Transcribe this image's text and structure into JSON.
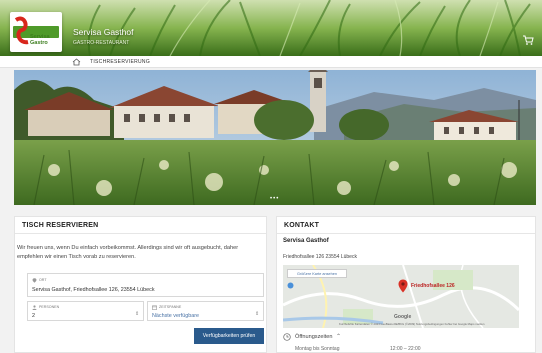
{
  "header": {
    "logo_text": "Servisa Gastro",
    "title": "Servisa Gasthof",
    "subtitle": "GASTRO-RESTAURANT"
  },
  "nav": {
    "reservation_label": "TISCHRESERVIERUNG"
  },
  "hero": {
    "carousel_dots": "•••"
  },
  "reservation": {
    "heading": "TISCH RESERVIEREN",
    "intro": "Wir freuen uns, wenn Du einfach vorbeikommst. Allerdings sind wir oft ausgebucht, daher empfehlen wir einen Tisch vorab zu reservieren.",
    "location_label": "ORT",
    "location_value": "Servisa Gasthof, Friedhofsallee 126, 23554 Lübeck",
    "persons_label": "PERSONEN",
    "persons_value": "2",
    "time_label": "ZEITSPANNE",
    "time_value": "Nächste verfügbare",
    "submit_label": "Verfügbarkeiten prüfen"
  },
  "contact": {
    "heading": "KONTAKT",
    "name": "Servisa Gasthof",
    "address": "Friedhofsallee 126 23554 Lübeck",
    "map_button": "Größere Karte ansehen",
    "map_pin_label": "Friedhofsallee 126",
    "map_google": "Google",
    "map_attribution": "Kurzbefehle   Kartendaten © 2023 GeoBasis-DE/BKG (©2009)   Nutzungsbedingungen   Fehler bei Google Maps melden",
    "opening_label": "Öffnungszeiten",
    "opening_days": "Montag bis Sonntag",
    "opening_time": "12:00 – 22:00"
  },
  "colors": {
    "primary_button": "#2a5a8c",
    "map_pin": "#d93025",
    "header_green": "#3d7a1e"
  }
}
